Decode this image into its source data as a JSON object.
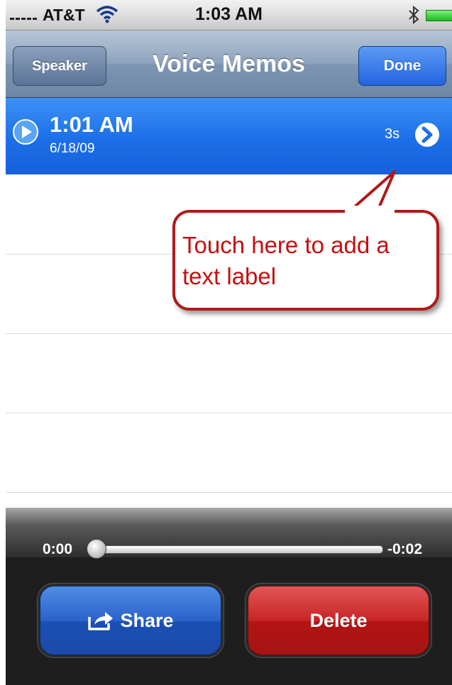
{
  "status_bar": {
    "carrier": "AT&T",
    "time": "1:03 AM",
    "icons": [
      "signal-bars",
      "wifi-icon",
      "bluetooth-icon",
      "battery-icon"
    ]
  },
  "nav_bar": {
    "left_button": "Speaker",
    "title": "Voice Memos",
    "right_button": "Done"
  },
  "memos": [
    {
      "time": "1:01 AM",
      "date": "6/18/09",
      "duration": "3s",
      "selected": true
    }
  ],
  "callout": {
    "text": "Touch here to add a text label"
  },
  "player": {
    "elapsed": "0:00",
    "remaining": "-0:02",
    "progress": 0,
    "share_label": "Share",
    "delete_label": "Delete"
  },
  "colors": {
    "selected_row": "#1d6fe8",
    "callout_border": "#b01a1a",
    "callout_text": "#c40f0f",
    "share_button": "#2a63c9",
    "delete_button": "#c82626"
  }
}
